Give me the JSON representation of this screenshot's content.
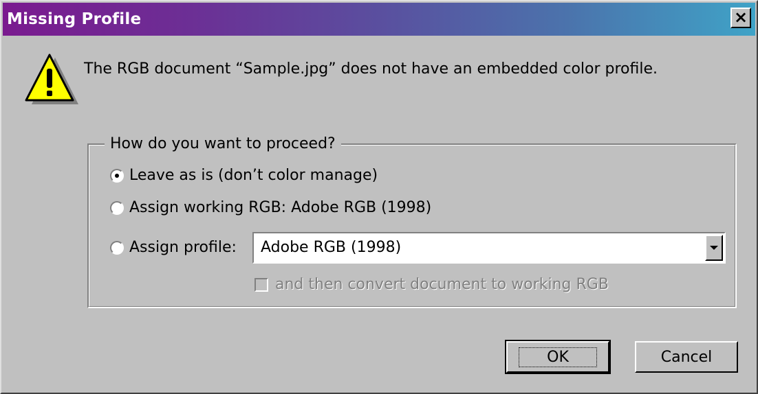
{
  "window": {
    "title": "Missing Profile",
    "close_label": "×"
  },
  "message": "The RGB document “Sample.jpg” does not have an embedded color profile.",
  "group": {
    "legend": "How do you want to proceed?",
    "options": [
      {
        "label": "Leave as is (don’t color manage)",
        "checked": true
      },
      {
        "label": "Assign working RGB:  Adobe RGB (1998)",
        "checked": false
      },
      {
        "label": "Assign profile:",
        "checked": false
      }
    ],
    "profile_select": {
      "value": "Adobe RGB (1998)"
    },
    "convert_checkbox": {
      "label": "and then convert document to working RGB",
      "checked": false,
      "disabled": true
    }
  },
  "buttons": {
    "ok": "OK",
    "cancel": "Cancel"
  },
  "icons": {
    "warning": "warning-icon",
    "close": "close-icon",
    "dropdown": "chevron-down-icon"
  },
  "colors": {
    "title_gradient_start": "#7a1a8f",
    "title_gradient_end": "#3fa3c7",
    "face": "#c0c0c0",
    "warning_yellow": "#ffff00"
  }
}
